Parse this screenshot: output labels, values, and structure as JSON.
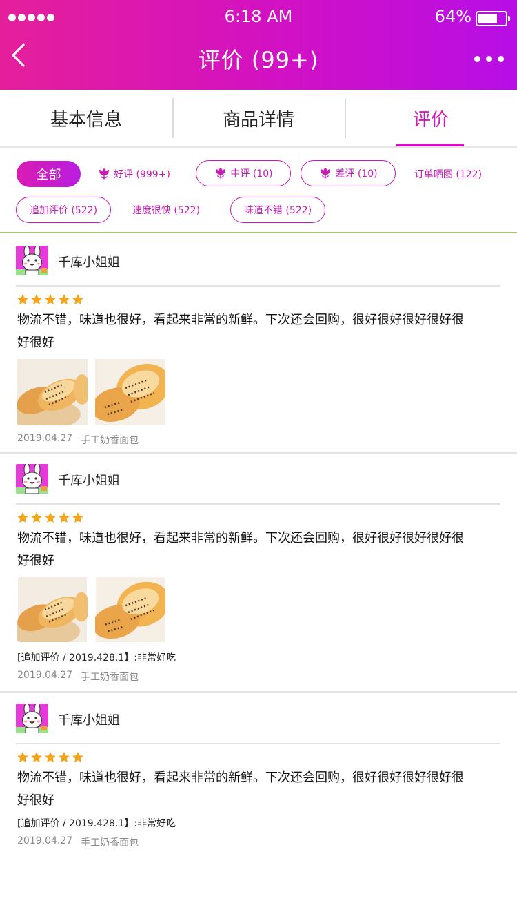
{
  "status_bar": {
    "time": "6:18 AM",
    "battery": "64%"
  },
  "header": {
    "title": "评价 (99+)"
  },
  "tabs": [
    {
      "label": "基本信息"
    },
    {
      "label": "商品详情"
    },
    {
      "label": "评价",
      "active": true
    }
  ],
  "filters": {
    "all": "全部",
    "good": "好评 (999+)",
    "medium": "中评 (10)",
    "bad": "差评 (10)",
    "photos": "订单晒图 (122)",
    "followup": "追加评价 (522)",
    "fast": "速度很快 (522)",
    "taste": "味道不错 (522)"
  },
  "reviews": [
    {
      "user": "千库小姐姐",
      "rating": 5,
      "text": "物流不错，味道也很好，看起来非常的新鲜。下次还会回购，很好很好很好很好很好很好",
      "followup": "",
      "date": "2019.04.27",
      "product": "手工奶香面包"
    },
    {
      "user": "千库小姐姐",
      "rating": 5,
      "text": "物流不错，味道也很好，看起来非常的新鲜。下次还会回购，很好很好很好很好很好很好",
      "followup": "[追加评价 / 2019.428.1】:非常好吃",
      "date": "2019.04.27",
      "product": "手工奶香面包"
    },
    {
      "user": "千库小姐姐",
      "rating": 5,
      "text": "物流不错，味道也很好，看起来非常的新鲜。下次还会回购，很好很好很好很好很好很好",
      "followup": "[追加评价 / 2019.428.1】:非常好吃",
      "date": "2019.04.27",
      "product": "手工奶香面包"
    }
  ],
  "colors": {
    "accent": "#d316b6",
    "star": "#f5a31a"
  }
}
